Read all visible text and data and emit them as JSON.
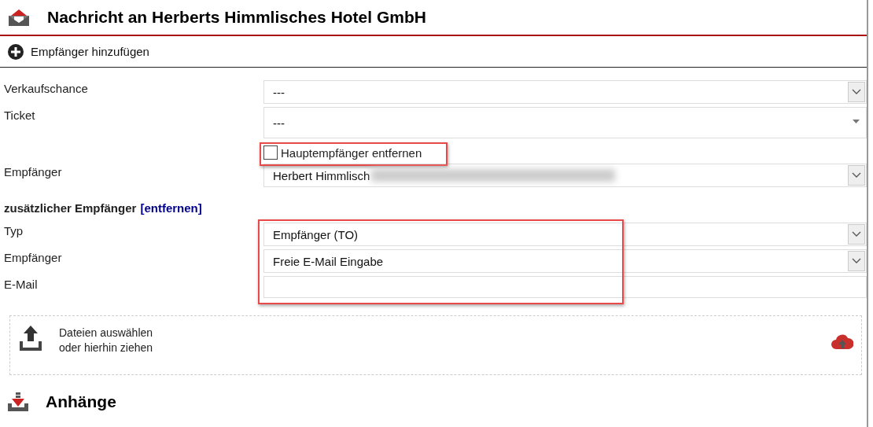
{
  "title": "Nachricht an Herberts Himmlisches Hotel GmbH",
  "add_recipient": "Empfänger hinzufügen",
  "fields_top": [
    {
      "label": "Verkaufschance",
      "value": "---",
      "kind": "select"
    },
    {
      "label": "Ticket",
      "value": "---",
      "kind": "ticket"
    }
  ],
  "remove_main": {
    "label": "Hauptempfänger entfernen",
    "checked": false,
    "highlighted": true
  },
  "recipient": {
    "label": "Empfänger",
    "value": "Herbert Himmlisch",
    "redacted": true
  },
  "additional": {
    "heading": "zusätzlicher Empfänger",
    "link": "[entfernen]",
    "highlighted": true,
    "fields": [
      {
        "label": "Typ",
        "value": "Empfänger (TO)",
        "kind": "select"
      },
      {
        "label": "Empfänger",
        "value": "Freie E-Mail Eingabe",
        "kind": "select"
      },
      {
        "label": "E-Mail",
        "kind": "input"
      }
    ]
  },
  "upload": {
    "lines": [
      "Dateien auswählen",
      "oder hierhin ziehen"
    ]
  },
  "attachments_title": "Anhänge"
}
